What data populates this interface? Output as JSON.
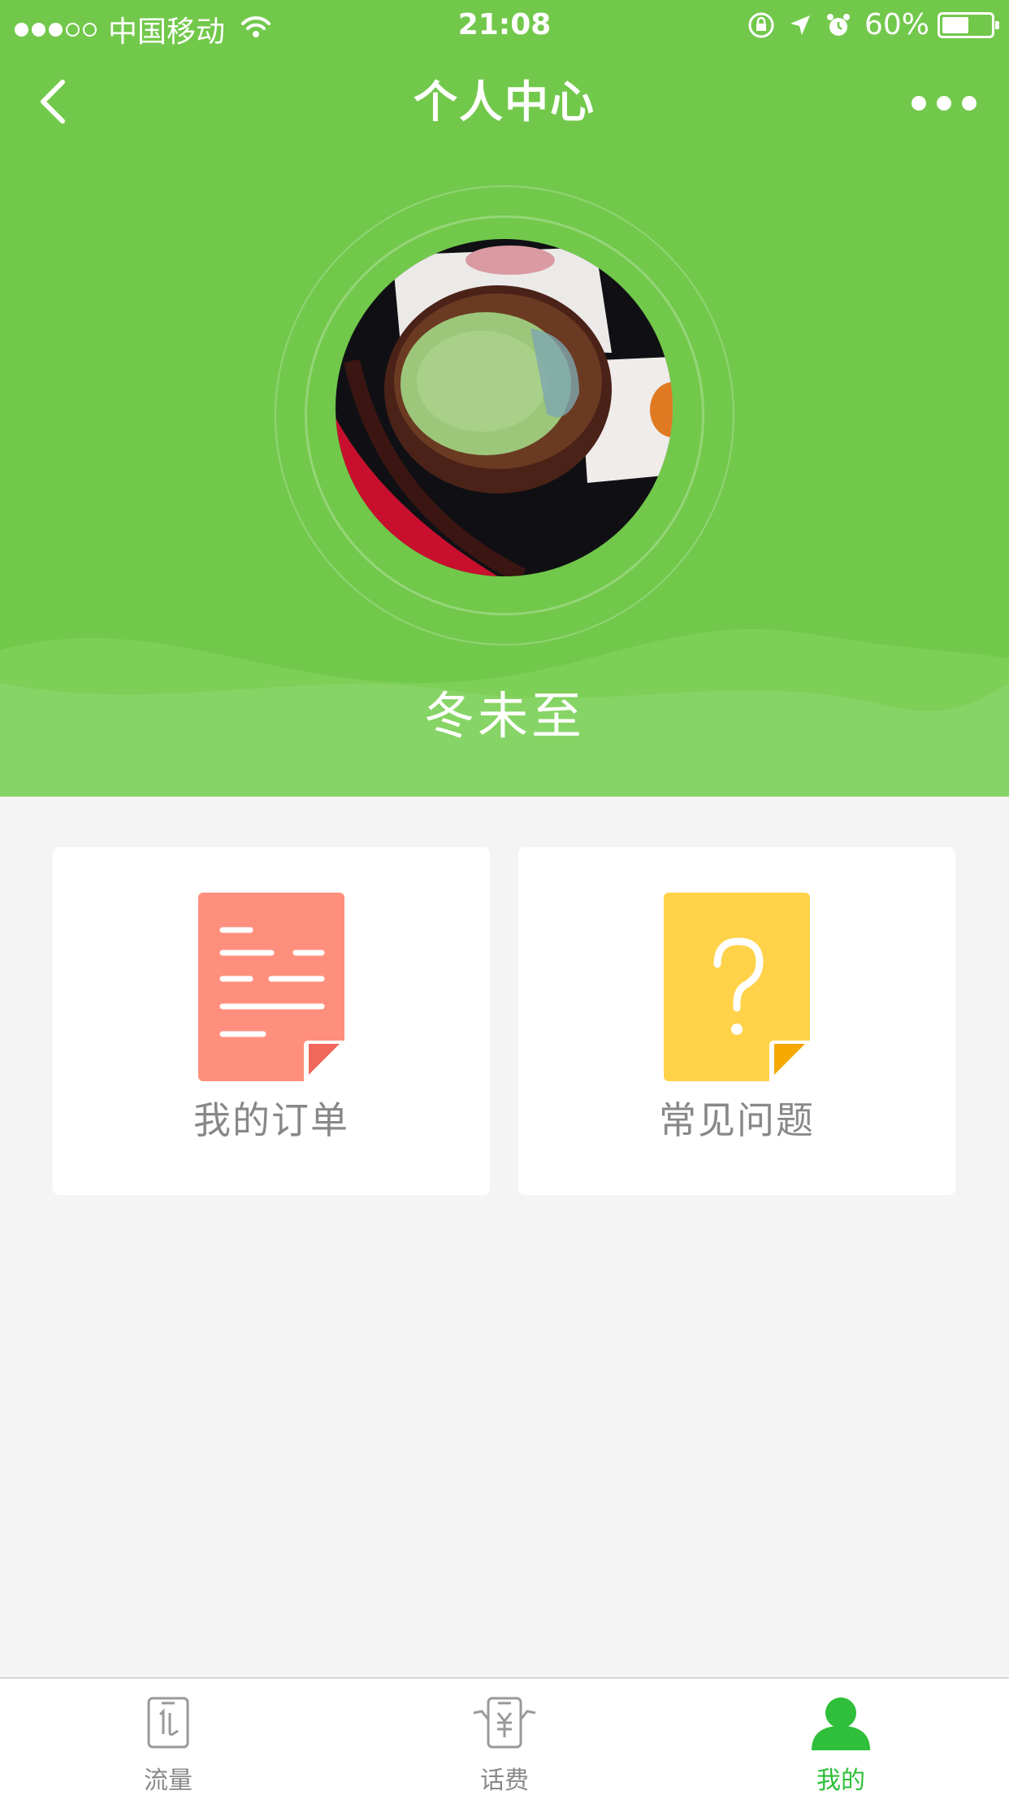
{
  "status_bar": {
    "carrier": "中国移动",
    "time": "21:08",
    "battery": "60%",
    "battery_level": 0.6,
    "signal_bars_filled": 3,
    "signal_bars_total": 5
  },
  "nav": {
    "title": "个人中心",
    "back_icon": "chevron-left-icon",
    "more_icon": "more-dots-icon"
  },
  "profile": {
    "username": "冬未至",
    "avatar_icon": "avatar-photo"
  },
  "cards": [
    {
      "label": "我的订单",
      "icon": "document-list-icon",
      "color": "#ff8f7d",
      "fold_color": "#f1685a"
    },
    {
      "label": "常见问题",
      "icon": "question-document-icon",
      "color": "#ffd24a",
      "fold_color": "#f5a800"
    }
  ],
  "tabs": [
    {
      "label": "流量",
      "icon": "data-traffic-icon",
      "active": false
    },
    {
      "label": "话费",
      "icon": "phone-bill-icon",
      "active": false
    },
    {
      "label": "我的",
      "icon": "user-icon",
      "active": true
    }
  ],
  "colors": {
    "header_green": "#72c84b",
    "page_background": "#f4f4f4",
    "tab_active": "#2fbf3a",
    "tab_inactive": "#888888"
  }
}
